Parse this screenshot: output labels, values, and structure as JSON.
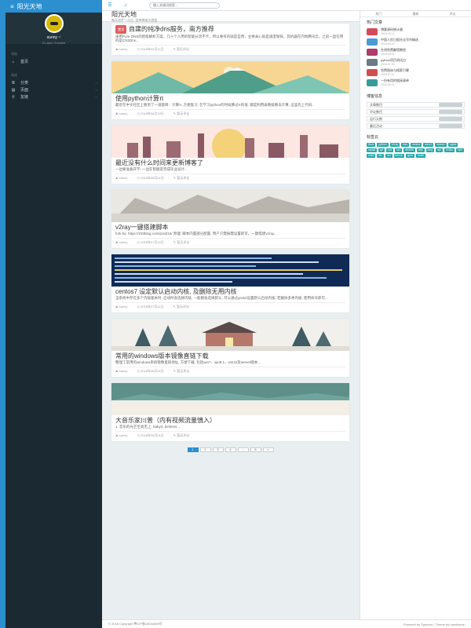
{
  "brand": {
    "title": "阳光天地"
  },
  "profile": {
    "name": "sunny ~",
    "subtitle": "A Laser Chemist"
  },
  "nav": {
    "group1": "导航",
    "home": "首页",
    "group2": "组成",
    "items": [
      {
        "icon": "layers-icon",
        "label": "分类"
      },
      {
        "icon": "doc-icon",
        "label": "页面"
      },
      {
        "icon": "link-icon",
        "label": "友链"
      }
    ]
  },
  "topbar": {
    "search_placeholder": "输入关键词搜索..."
  },
  "header": {
    "title": "阳光天地",
    "subtitle": "每天进步一点点, 坚持带来大改变"
  },
  "posts": [
    {
      "badge": "置顶",
      "title": "自建的纯净dns服务，南方推荐",
      "excerpt": "采用Pure DNS的智能解析方案，几十个人用的智能分流不卡，所以要有的就是自用，主要关心就是速度够快，其机器在内地腾讯云，之前一直在用的是CN2Dns...",
      "author": "sunny",
      "date": "2018年09月11日",
      "comments": "暂无评论",
      "thumb": "none"
    },
    {
      "title": "使用python计算π",
      "excerpt": "最近在中文社区上看到了一道题目：计算π, 方便复习, 在学习python的时候算过π的值, 都是利用泰勒级数去计算, 这里先上代码..",
      "author": "sunny",
      "date": "2018年08月19日",
      "comments": "暂无评论",
      "thumb": "mountains"
    },
    {
      "title": "最近没有什么时间来更新博客了",
      "excerpt": "一边要准备开学, 一边在帮朋友完成毕业设计...",
      "author": "sunny",
      "date": "2018年08月01日",
      "comments": "暂无评论",
      "thumb": "city"
    },
    {
      "title": "v2ray一键搭建脚本",
      "excerpt": "fork by: https://233blog.com/post/16/ 原理: 脚本内置部分配置, 用户只需按需设置即可。一键搭建v2ray...",
      "author": "sunny",
      "date": "2018年07月22日",
      "comments": "暂无评论",
      "thumb": "snow"
    },
    {
      "title": "centos7 设定默认启动内核, 及删除无用内核",
      "excerpt": "当系统中存在多个内核版本时, 启动时会选择内核, 一般都会选择默认, 可以通过grub2设置默认启动内核, 若删除多余内核, 使用命令即可...",
      "author": "sunny",
      "date": "2018年07月11日",
      "comments": "暂无评论",
      "thumb": "terminal"
    },
    {
      "title": "常用的windows版本镜像直链下载",
      "excerpt": "整理了常用的windows系统镜像直链地址, 方便下载, 包括win7、win8.1、win10及server版本...",
      "author": "sunny",
      "date": "2018年06月21日",
      "comments": "暂无评论",
      "thumb": "cabin"
    },
    {
      "title": "大音乐家川普（内有视频流量慎入）",
      "excerpt": "1. 音乐的光芒至高无上, baby3, believer...",
      "author": "sunny",
      "date": "2018年06月01日",
      "comments": "暂无评论",
      "thumb": "lake"
    }
  ],
  "pagination": [
    "1",
    "2",
    "3",
    "4",
    "...",
    "8",
    "»"
  ],
  "rightbar": {
    "tabs": [
      "热门",
      "最新",
      "评论"
    ],
    "hot_title": "热门文章",
    "hot": [
      {
        "title": "博客源码统计器",
        "date": "2018.09.11",
        "color": "#d64a5a"
      },
      {
        "title": "中国人民日报社论写作精选",
        "date": "2018.08.19",
        "color": "#4a9ad6"
      },
      {
        "title": "在线免费翻墙教程",
        "date": "2018.08.01",
        "color": "#b03a6a"
      },
      {
        "title": "python项目测试点",
        "date": "2018.07.22",
        "color": "#6a7a86"
      },
      {
        "title": "免费图床与搜索引擎",
        "date": "2018.07.11",
        "color": "#d05050"
      },
      {
        "title": "一份有用的链接清单",
        "date": "2018.06.21",
        "color": "#3a9a9a"
      }
    ],
    "info_title": "博客信息",
    "info": [
      "文章数目",
      "评论数目",
      "运行天数",
      "最后活动"
    ],
    "tags_title": "标签云",
    "tags": [
      "linux",
      "python",
      "v2ray",
      "dns",
      "centos",
      "win10",
      "docker",
      "nginx",
      "mysql",
      "git",
      "vps",
      "ssr",
      "ubuntu",
      "php",
      "blog",
      "api",
      "music",
      "vpn",
      "shell",
      "bbr",
      "ssl",
      "kernel",
      "grub",
      "math"
    ]
  },
  "footer": {
    "left": "© 2018 Copyright 粤ICP备18034659号",
    "right": "Powered by Typecho | Theme by handsome"
  }
}
